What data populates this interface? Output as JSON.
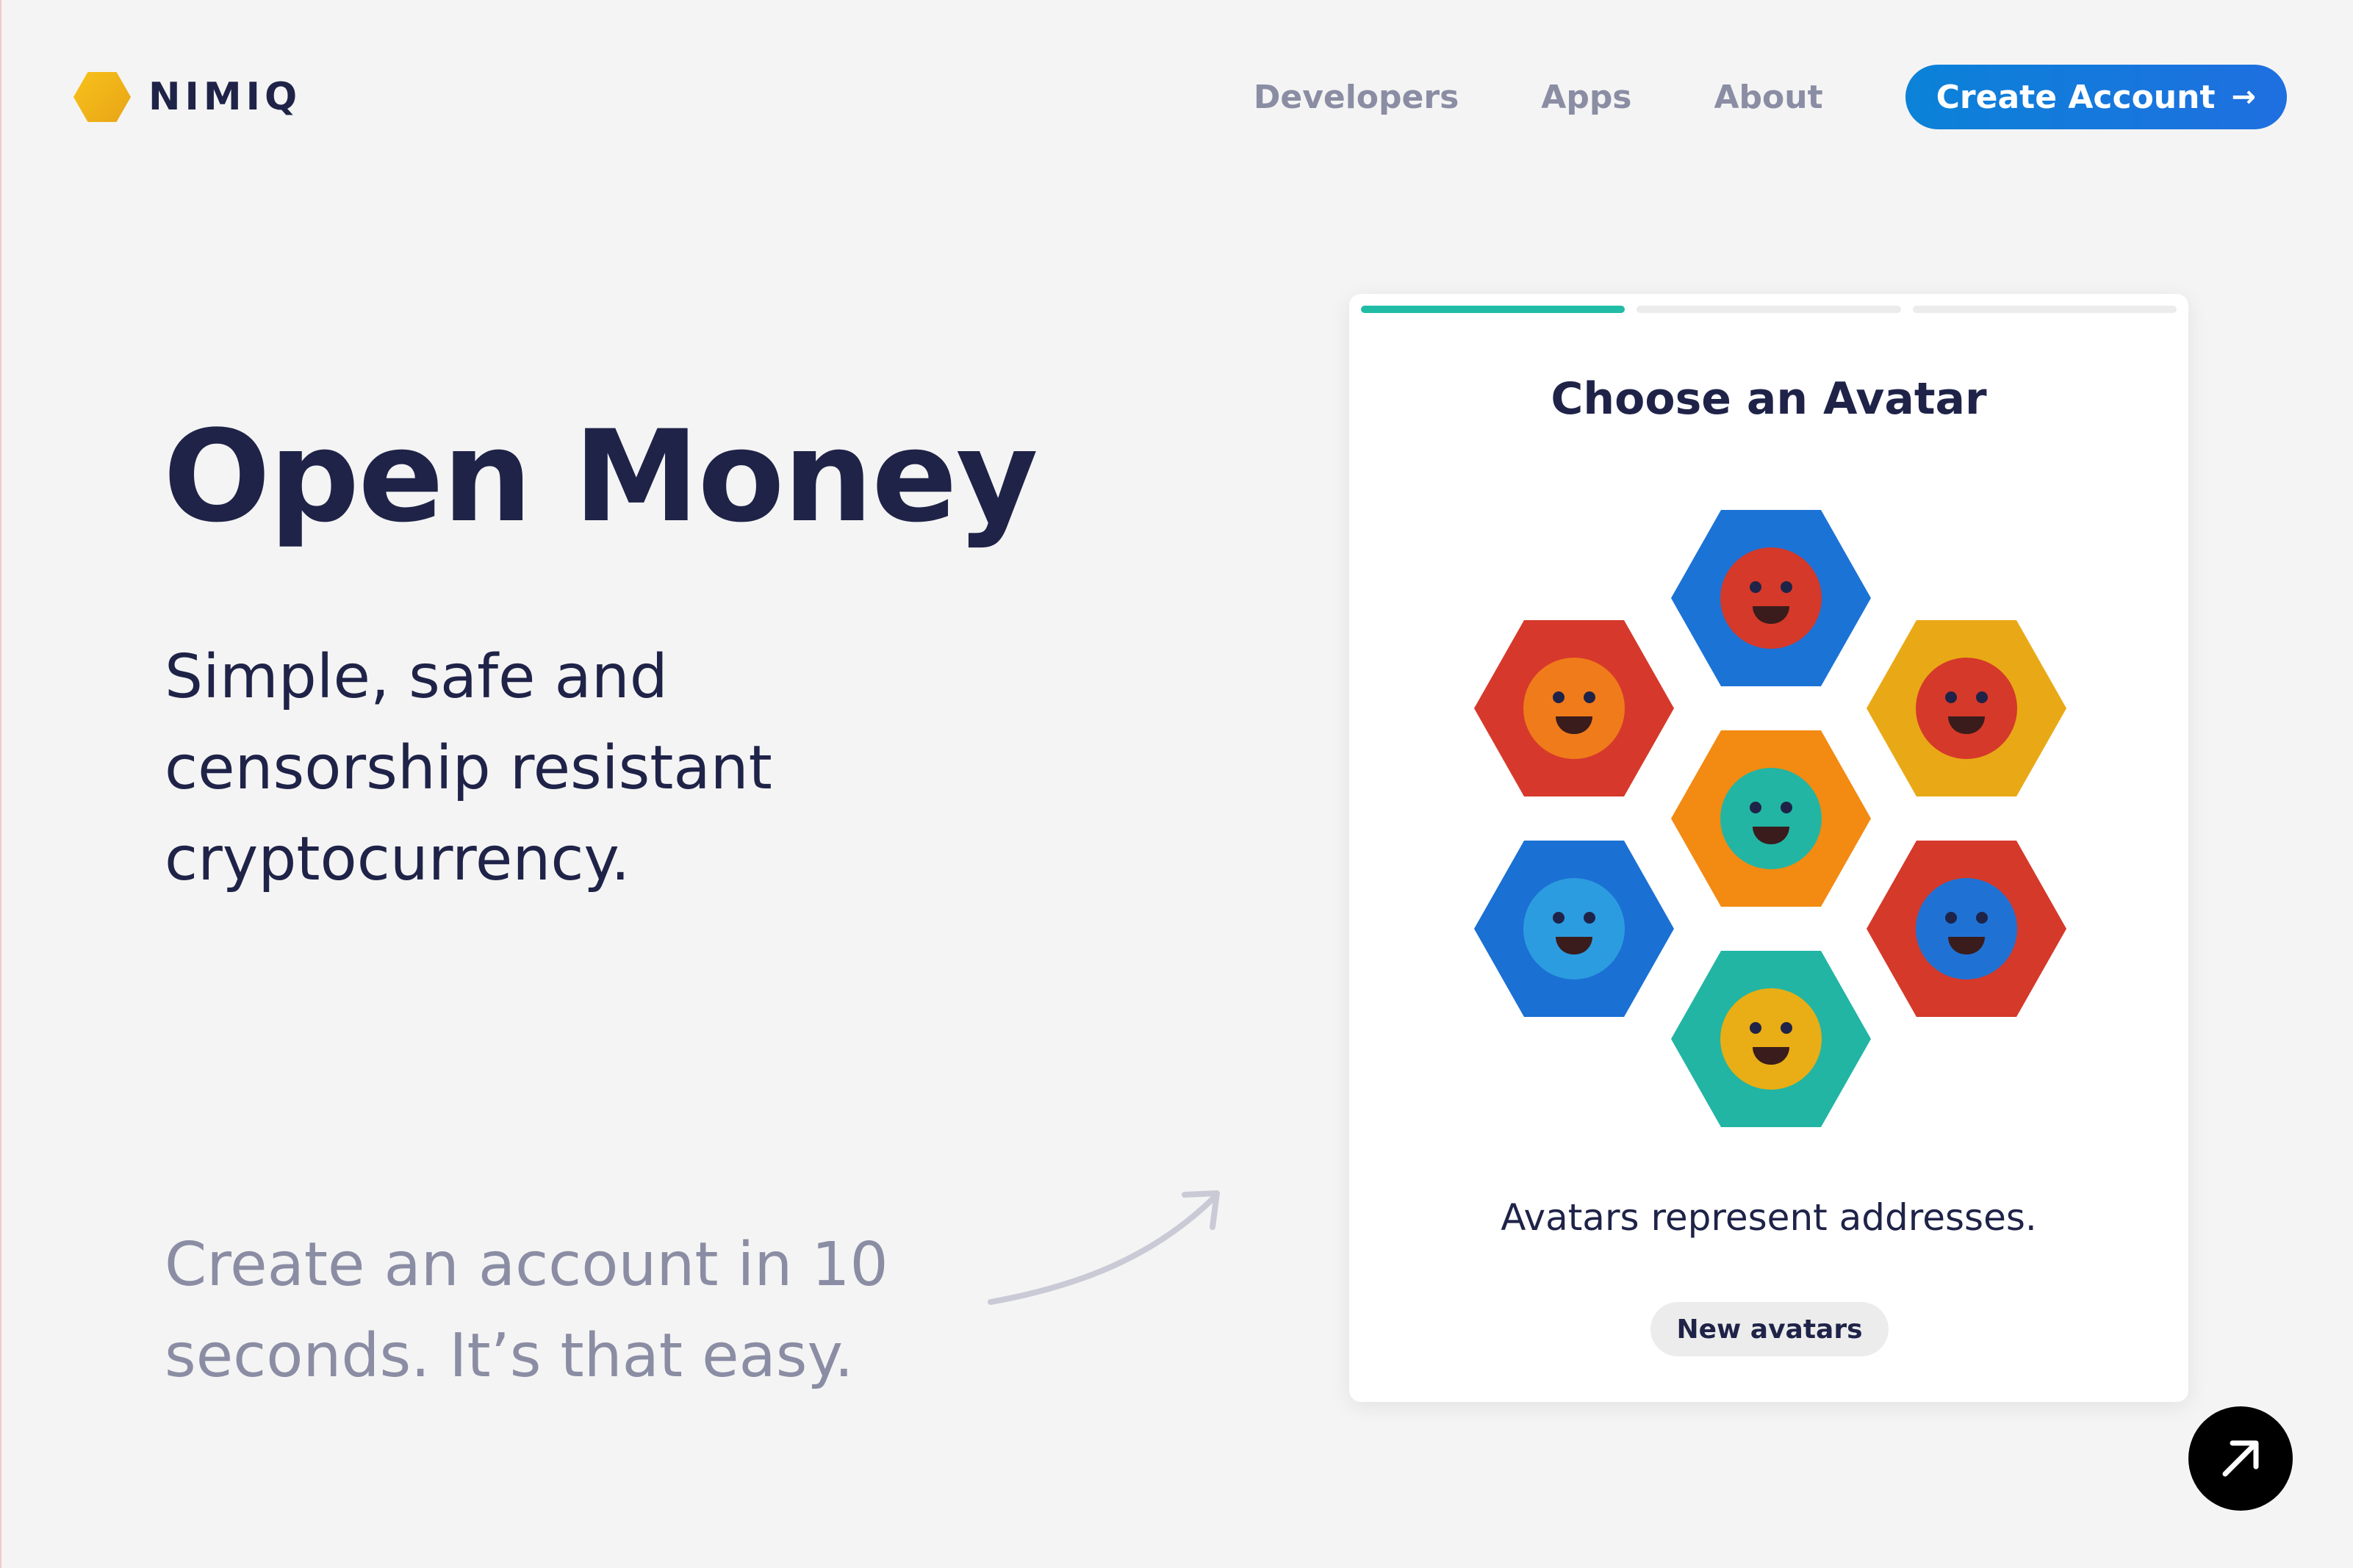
{
  "brand": {
    "name": "NIMIQ",
    "color": "#f1b41b"
  },
  "nav": {
    "links": [
      "Developers",
      "Apps",
      "About"
    ],
    "cta_label": "Create Account",
    "cta_icon": "arrow-right-icon",
    "cta_color": "#0b82d8"
  },
  "hero": {
    "title": "Open Money",
    "subtitle": "Simple, safe and censorship resistant cryptocurrency.",
    "note": "Create an account in 10 seconds. It’s that easy."
  },
  "card": {
    "progress": {
      "total_steps": 3,
      "current_step": 1,
      "active_color": "#21bca5"
    },
    "title": "Choose an Avatar",
    "caption": "Avatars represent addresses.",
    "new_avatars_label": "New avatars",
    "avatars": [
      {
        "name": "avatar-red-on-blue",
        "bg": "#1b73d6",
        "body": "#d5392a"
      },
      {
        "name": "avatar-orange-on-red",
        "bg": "#d6392b",
        "body": "#f07b1b"
      },
      {
        "name": "avatar-red-on-yellow",
        "bg": "#e9a916",
        "body": "#d5392a"
      },
      {
        "name": "avatar-teal-on-orange",
        "bg": "#f38a12",
        "body": "#22b5a3"
      },
      {
        "name": "avatar-blue-on-blue",
        "bg": "#1a70d3",
        "body": "#2c9ce0"
      },
      {
        "name": "avatar-blue-on-red",
        "bg": "#d5392a",
        "body": "#1f72d4"
      },
      {
        "name": "avatar-yellow-on-teal",
        "bg": "#22b5a3",
        "body": "#e9ad15"
      }
    ]
  },
  "fab": {
    "icon": "arrow-up-right-icon"
  }
}
